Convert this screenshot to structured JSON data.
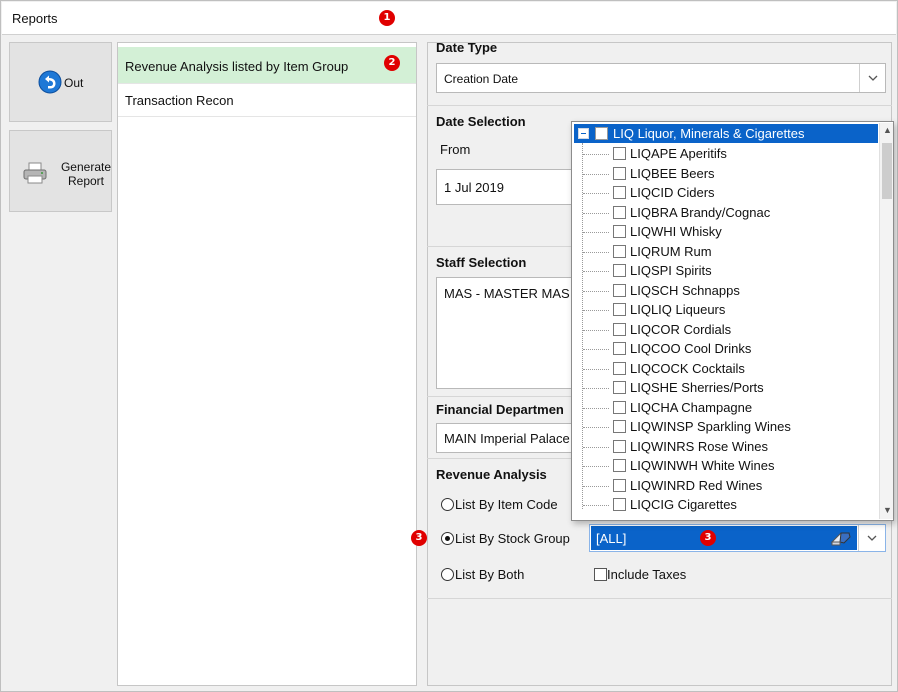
{
  "window": {
    "title": "Reports"
  },
  "markers": [
    "1",
    "2",
    "3",
    "3"
  ],
  "sidebar": {
    "out_label": "Out",
    "generate_label_1": "Generate",
    "generate_label_2": "Report"
  },
  "report_list": {
    "items": [
      {
        "label": "Revenue Analysis listed by Item Group",
        "selected": true
      },
      {
        "label": "Transaction Recon",
        "selected": false
      }
    ]
  },
  "date_type": {
    "title": "Date Type",
    "value": "Creation Date"
  },
  "date_selection": {
    "title": "Date Selection",
    "from_label": "From",
    "from_value": "1 Jul 2019"
  },
  "staff_selection": {
    "title": "Staff Selection",
    "value": "MAS - MASTER MAS"
  },
  "financial_department": {
    "title": "Financial Departmen",
    "value": "MAIN Imperial Palace"
  },
  "revenue_analysis": {
    "title": "Revenue Analysis",
    "options": [
      {
        "label": "List By Item Code",
        "checked": false
      },
      {
        "label": "List By Stock Group",
        "checked": true
      },
      {
        "label": "List By Both",
        "checked": false
      }
    ],
    "include_taxes_label": "Include Taxes",
    "include_taxes_checked": false,
    "stock_group_value": "[ALL]"
  },
  "stock_group_tree": {
    "root": "LIQ Liquor, Minerals & Cigarettes",
    "items": [
      "LIQAPE Aperitifs",
      "LIQBEE Beers",
      "LIQCID Ciders",
      "LIQBRA Brandy/Cognac",
      "LIQWHI Whisky",
      "LIQRUM Rum",
      "LIQSPI Spirits",
      "LIQSCH Schnapps",
      "LIQLIQ Liqueurs",
      "LIQCOR Cordials",
      "LIQCOO Cool Drinks",
      "LIQCOCK Cocktails",
      "LIQSHE Sherries/Ports",
      "LIQCHA Champagne",
      "LIQWINSP Sparkling Wines",
      "LIQWINRS Rose Wines",
      "LIQWINWH White Wines",
      "LIQWINRD Red Wines",
      "LIQCIG Cigarettes"
    ]
  },
  "colors": {
    "selection_blue": "#0a63c9",
    "selected_report_green": "#d3f0d6",
    "marker_red": "#e00000"
  }
}
